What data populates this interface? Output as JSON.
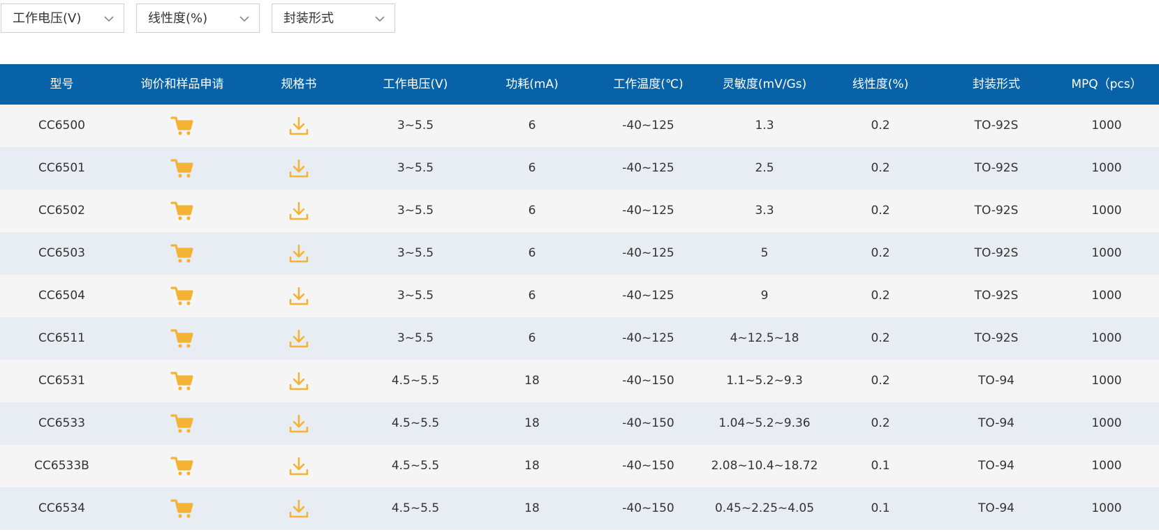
{
  "filters": [
    {
      "label": "工作电压(V)"
    },
    {
      "label": "线性度(%)"
    },
    {
      "label": "封装形式"
    }
  ],
  "colors": {
    "header_bg": "#0862a8",
    "row_light": "#f5f5f5",
    "row_blue": "#e7edf2",
    "icon_orange": "#f5b335"
  },
  "icons": {
    "inquiry": "shopping-cart-icon",
    "datasheet": "download-icon",
    "filter_chevron": "chevron-down-icon"
  },
  "table": {
    "headers": [
      "型号",
      "询价和样品申请",
      "规格书",
      "工作电压(V)",
      "功耗(mA)",
      "工作温度(℃)",
      "灵敏度(mV/Gs)",
      "线性度(%)",
      "封装形式",
      "MPQ（pcs）"
    ],
    "rows": [
      {
        "model": "CC6500",
        "voltage": "3~5.5",
        "power": "6",
        "temp": "-40~125",
        "sensitivity": "1.3",
        "linearity": "0.2",
        "package": "TO-92S",
        "mpq": "1000"
      },
      {
        "model": "CC6501",
        "voltage": "3~5.5",
        "power": "6",
        "temp": "-40~125",
        "sensitivity": "2.5",
        "linearity": "0.2",
        "package": "TO-92S",
        "mpq": "1000"
      },
      {
        "model": "CC6502",
        "voltage": "3~5.5",
        "power": "6",
        "temp": "-40~125",
        "sensitivity": "3.3",
        "linearity": "0.2",
        "package": "TO-92S",
        "mpq": "1000"
      },
      {
        "model": "CC6503",
        "voltage": "3~5.5",
        "power": "6",
        "temp": "-40~125",
        "sensitivity": "5",
        "linearity": "0.2",
        "package": "TO-92S",
        "mpq": "1000"
      },
      {
        "model": "CC6504",
        "voltage": "3~5.5",
        "power": "6",
        "temp": "-40~125",
        "sensitivity": "9",
        "linearity": "0.2",
        "package": "TO-92S",
        "mpq": "1000"
      },
      {
        "model": "CC6511",
        "voltage": "3~5.5",
        "power": "6",
        "temp": "-40~125",
        "sensitivity": "4~12.5~18",
        "linearity": "0.2",
        "package": "TO-92S",
        "mpq": "1000"
      },
      {
        "model": "CC6531",
        "voltage": "4.5~5.5",
        "power": "18",
        "temp": "-40~150",
        "sensitivity": "1.1~5.2~9.3",
        "linearity": "0.2",
        "package": "TO-94",
        "mpq": "1000"
      },
      {
        "model": "CC6533",
        "voltage": "4.5~5.5",
        "power": "18",
        "temp": "-40~150",
        "sensitivity": "1.04~5.2~9.36",
        "linearity": "0.2",
        "package": "TO-94",
        "mpq": "1000"
      },
      {
        "model": "CC6533B",
        "voltage": "4.5~5.5",
        "power": "18",
        "temp": "-40~150",
        "sensitivity": "2.08~10.4~18.72",
        "linearity": "0.1",
        "package": "TO-94",
        "mpq": "1000"
      },
      {
        "model": "CC6534",
        "voltage": "4.5~5.5",
        "power": "18",
        "temp": "-40~150",
        "sensitivity": "0.45~2.25~4.05",
        "linearity": "0.1",
        "package": "TO-94",
        "mpq": "1000"
      }
    ]
  }
}
